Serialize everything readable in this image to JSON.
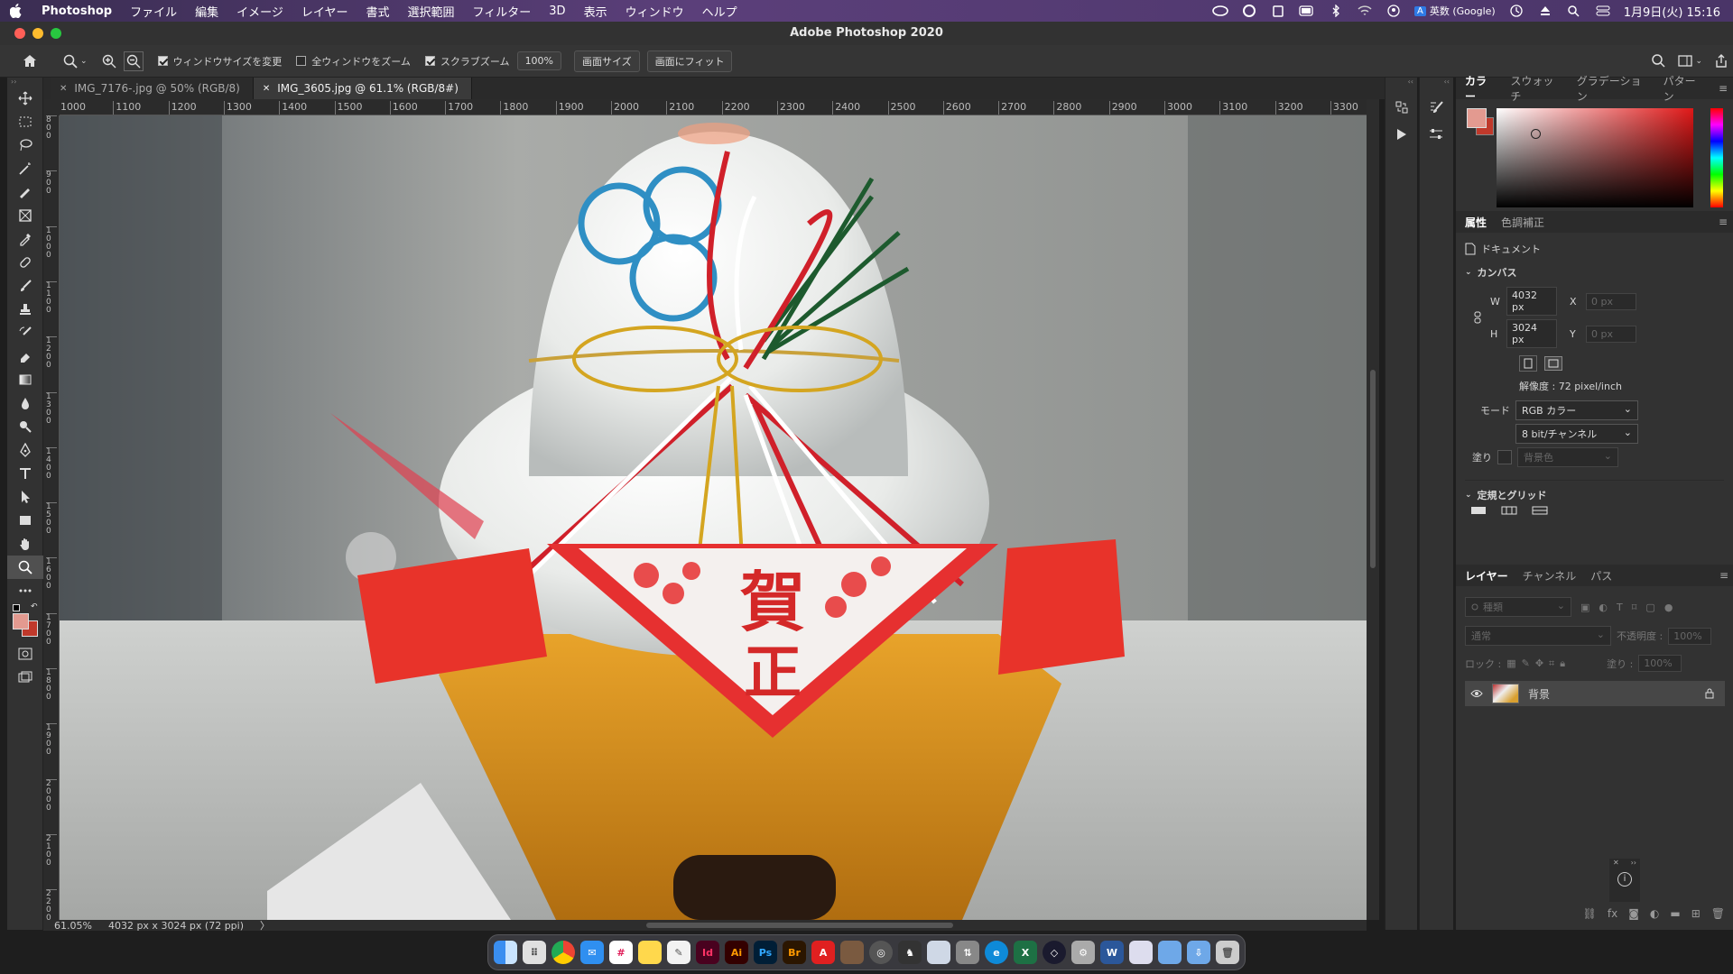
{
  "menubar": {
    "app": "Photoshop",
    "items": [
      "ファイル",
      "編集",
      "イメージ",
      "レイヤー",
      "書式",
      "選択範囲",
      "フィルター",
      "3D",
      "表示",
      "ウィンドウ",
      "ヘルプ"
    ],
    "input_method": "英数 (Google)",
    "clock": "1月9日(火)  15:16"
  },
  "window": {
    "title": "Adobe Photoshop 2020"
  },
  "options": {
    "resize_windows": "ウィンドウサイズを変更",
    "zoom_all": "全ウィンドウをズーム",
    "scrubby": "スクラブズーム",
    "zoom_value": "100%",
    "fit_screen": "画面サイズ",
    "fill_screen": "画面にフィット"
  },
  "tabs": [
    {
      "label": "IMG_7176-.jpg @ 50% (RGB/8)"
    },
    {
      "label": "IMG_3605.jpg @ 61.1% (RGB/8#)"
    }
  ],
  "ruler": {
    "top": [
      "1000",
      "1100",
      "1200",
      "1300",
      "1400",
      "1500",
      "1600",
      "1700",
      "1800",
      "1900",
      "2000",
      "2100",
      "2200",
      "2300",
      "2400",
      "2500",
      "2600",
      "2700",
      "2800",
      "2900",
      "3000",
      "3100",
      "3200",
      "3300"
    ],
    "left": [
      "800",
      "900",
      "1000",
      "1100",
      "1200",
      "1300",
      "1400",
      "1500",
      "1600",
      "1700",
      "1800",
      "1900",
      "2000",
      "2100",
      "2200"
    ]
  },
  "image": {
    "kanji_top": "賀",
    "kanji_bottom": "正"
  },
  "status": {
    "zoom": "61.05%",
    "doc": "4032 px x 3024 px (72 ppi)",
    "arrow": "〉"
  },
  "panels": {
    "color_tabs": [
      "カラー",
      "スウォッチ",
      "グラデーション",
      "パターン"
    ],
    "props_tabs": [
      "属性",
      "色調補正"
    ],
    "document": "ドキュメント",
    "canvas_title": "カンバス",
    "w_label": "W",
    "w_value": "4032 px",
    "h_label": "H",
    "h_value": "3024 px",
    "x_label": "X",
    "x_value": "0 px",
    "y_label": "Y",
    "y_value": "0 px",
    "resolution": "解像度 : 72 pixel/inch",
    "mode_label": "モード",
    "mode_value": "RGB カラー",
    "depth_value": "8 bit/チャンネル",
    "fill_label": "塗り",
    "fill_value": "背景色",
    "rulers_title": "定規とグリッド",
    "layer_tabs": [
      "レイヤー",
      "チャンネル",
      "パス"
    ],
    "kind": "種類",
    "blend": "通常",
    "opacity_label": "不透明度 :",
    "opacity_value": "100%",
    "lock_label": "ロック :",
    "fill2_label": "塗り :",
    "fill2_value": "100%",
    "layer_name": "背景"
  },
  "colors": {
    "fg": "#e39a90",
    "bg": "#c0392b",
    "accent": "#e02020"
  },
  "dock": [
    "Finder",
    "Launchpad",
    "Chrome",
    "Mail",
    "Slack",
    "Notes",
    "TextEdit",
    "Id",
    "Ai",
    "Ps",
    "Br",
    "Acrobat",
    "Photos",
    "Compass",
    "Evernote",
    "Preview",
    "Migration",
    "Edge",
    "Excel",
    "VPN",
    "Sysprefs",
    "Word",
    "Files",
    "Desktop",
    "Downloads",
    "Trash"
  ]
}
